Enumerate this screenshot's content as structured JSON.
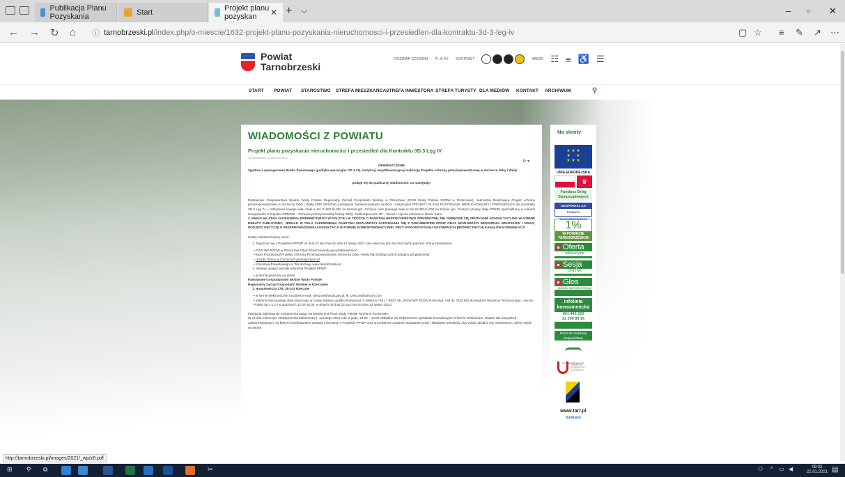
{
  "browser": {
    "tabs": [
      {
        "label": "Publikacja Planu Pozyskania",
        "favicon_color": "#4a90d9"
      },
      {
        "label": "Start",
        "favicon_color": "#e6a532"
      },
      {
        "label": "Projekt planu pozyskan",
        "favicon_color": "#7bbbd6"
      }
    ],
    "url_host": "tarnobrzeski.pl",
    "url_path": "/index.php/o-miescie/1632-projekt-planu-pozyskania-nieruchomosci-i-przesiedlen-dla-kontraktu-3d-3-leg-iv",
    "status_link": "http://tarnobrzeski.pl/images/2021/_wp/z8.pdf"
  },
  "site": {
    "logo_line1": "Powiat",
    "logo_line2": "Tarnobrzeski",
    "tools": {
      "font_size_label": "ROZMIAR CZCIONKI",
      "font_sizes": "A- A A+",
      "contrast_label": "KONTRAST",
      "view_label": "WIDOK"
    },
    "nav": [
      "START",
      "POWIAT",
      "STAROSTWO",
      "STREFA MIESZKAŃCA",
      "STREFA INWESTORA",
      "STREFA TURYSTY",
      "DLA MEDIÓW",
      "KONTAKT",
      "ARCHIWUM"
    ]
  },
  "article": {
    "section": "WIADOMOŚCI Z POWIATU",
    "title": "Projekt planu pozyskania nieruchomości i przesiedleń dla Kontraktu 3D.3 Łęg IV",
    "published": "Opublikowano: 22 styczeń 2021",
    "heading": "OBWIESZCZENIE",
    "intro": "Zgodnie z wymaganiami Banku Światowego (polityka operacyjna OP 4.12), instytucji współfinansującej realizację Projektu ochrony przeciwpowodziowej w dorzeczu Odry i Wisły",
    "announce": "podaje się do publicznej wiadomości, co następuje:",
    "p1": "Państwowe Gospodarstwo Wodne Wody Polskie Regionalny Zarząd Gospodarki Wodnej w Rzeszowie (PGW Wody Polskie RZGW w Rzeszowie), Jednostka Realizująca Projekt ochrony przeciwpowodziowej w dorzeczu Odry i Wisły (JRP OPDOW) udostępnia zainteresowanym osobom i instytucjom PROJEKT PLANU POZYSKANIA NIERUCHOMOŚCI I PRZESIEDLEŃ dla Kontraktu 3D.3 Łęg IV – rozbudowa lewego wału rzeki w km 0+062-5+250 na terenie gm. Gorzyce oraz prawego wału w km 0+000-5+236 na terenie gm. Gorzyce (zwany dalej PPNIP) sporządzony w ramach Komponentu 3 Projektu OPDOW – Ochrona przed powodzią Górnej Wisły. Podkomponentu 3D – Biema i czynna ochrona w zlewni Sanu.",
    "p2": "Z UWAGI NA STAN ZAGROŻENIA EPIDEMICZNEGO W POLSCE I W TROSCE O PAŃSTWA BEZPIECZEŃSTWO ZDROWOTNE, NIE ODBĘDZIE SIĘ SPOTKANIE KONSULTACYJNE W FORMIE DEBATY PUBLICZNEJ, JEDNAK W CELU ZAPEWNIENIA PAŃSTWU MOŻLIWOŚCI ZAPOZNANIA SIĘ Z DOKUMENTEM PPNIP ORAZ MOŻLIWOŚCI WNOSZENIA WNIOSKÓW I UWAG, PODJĘTO DECYZJĘ O PRZEPROWADZENIU KONSULTACJI W FORMIE KORESPONDENCYJNEJ PRZY WYKORZYSTANIU DOSTĘPNYCH (BEZPIECZNYCH) KANAŁÓW KOMUNIKACJI",
    "dot": ".",
    "each": "Każdy zainteresowany może:",
    "item1": "1. Zapoznać się z Projektem PPNIP od dnia 22 stycznia do dnia 12 lutego 2021 roku włącznie (16 dni roboczych) poprzez strony internetowe:",
    "links": [
      "PGW WP RZGW w Rzeszowie https://rzeszow.wody.gov.pl/aktualnosci/",
      "Biura Koordynacji Projektu Ochrony Przeciwpowodziowej Dorzecza Odry i Wisły http://odrapcu2019.odrapcu.pl/ogloszenia/",
      "Urzędu Gminy w Gorzycach gminagorzyce.pl",
      "Starostwa Powiatowego w Tarnobrzegu www.tarnobrzeski.pl"
    ],
    "item2": "1. Składać uwagi i wnioski odnośnie Projektu PPNIP:",
    "written": "w formie pisemnej na adres:",
    "addr1": "Państwowe Gospodarstwo Wodne Wody Polskie",
    "addr2": "Regionalny Zarząd Gospodarki Wodnej w Rzeszowie",
    "addr3": "1. Hanasiewicza 17B, 35-103 Rzeszów",
    "email": "w formie elektronicznej na adres e-mail: rzeszow@wody.gov.pl, lk_rzeszow@aecom.com",
    "phone": "telefonicznie każdego dnia roboczego w czasie trwania upublicznienia pod nr telefonu +48 17 8537 441 (PGW WP RZGW Rzeszów), +48 32 7822 852 (Konsultant Wsparcia Technicznego - Aecom Polska Sp.z o.o.) w godzinach 12.00-15.00, w dniach od dnia 22 stycznia do dnia 12 lutego 2021r.",
    "inst": "Instytucją właściwą do rozpatrzenia uwag i wniosków jest PGW Wody Polskie RZGW w Rzeszowie.",
    "last": "W 16 dniu roboczym udostępnienia dokumentu tj. 12 lutego 2021 roku o godz. 14:00 – 16:00 odbędzie się elektroniczne spotkanie konsultacyjne w formie webinarium, otwarte dla wszystkich zainteresowanych, na którym przedstawione zostaną informacje o Projekcie PPNIP oraz umożliwione zostanie zadawanie pytań i składanie wniosków. Aby wziąć udział w ww. webinarium, należy wejść na stronę"
  },
  "sidebar": {
    "title": "Na skróty",
    "eu_caption": "UNIA EUROPEJSKA",
    "fds": "Fundusz Dróg Samorządowych",
    "geo_top": "GEOPORTAL 2.0",
    "geo_bottom": "POWIATU TARNOBRZESKIEGO",
    "pct_big": "1%",
    "pct_small": "W POWIECIE TARNOBRZESKIM",
    "oferta_a": "Oferta",
    "oferta_b": "edukacyjna",
    "sesja_a": "Sesja",
    "sesja_b": "ONLINE",
    "glos_a": "Głos",
    "glos_b": "powiatu tarnobrzeskiego",
    "info_a": "infolinia",
    "info_b": "konsumencka",
    "info_num1": "801 440 220",
    "info_num2": "22 290 89 16",
    "ros": "Dziennik Urzędowy Województwa Podkarpackiego",
    "pk": "PODKARPACKIE",
    "zpp": "ZWIĄZEK POWIATÓW POLSKICH",
    "tarr": "www.tarr.pl",
    "tarr_sub": "fundusze"
  },
  "taskbar": {
    "time": "09:02",
    "date": "22.01.2021"
  },
  "colors": {
    "accent_green": "#2e7d32",
    "taskbar": "#142033"
  }
}
